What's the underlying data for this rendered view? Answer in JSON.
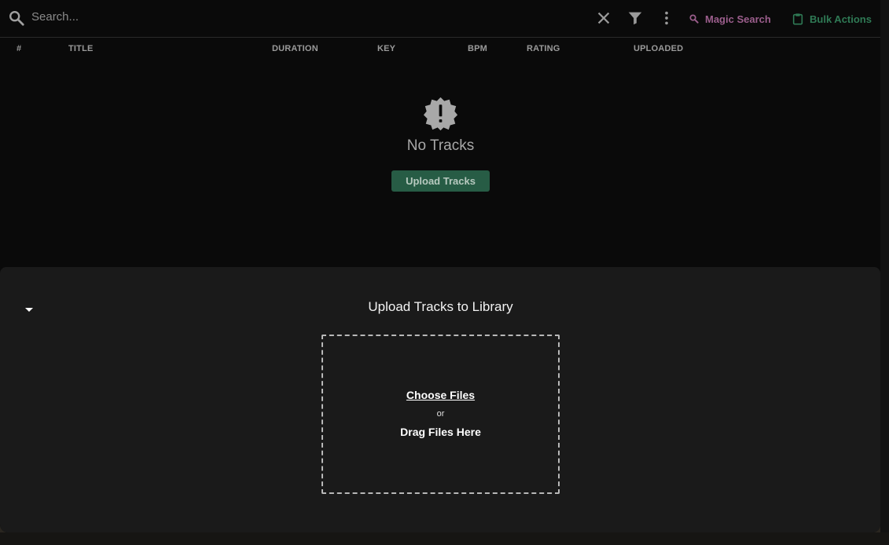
{
  "search": {
    "placeholder": "Search..."
  },
  "toolbar": {
    "clear_icon": "close-icon",
    "filter_icon": "filter-icon",
    "more_icon": "more-vert-icon",
    "magic_search_label": "Magic Search",
    "bulk_actions_label": "Bulk Actions"
  },
  "table": {
    "columns": [
      "#",
      "TITLE",
      "DURATION",
      "KEY",
      "BPM",
      "RATING",
      "UPLOADED"
    ]
  },
  "empty_state": {
    "icon": "alert-badge-icon",
    "title": "No Tracks",
    "button_label": "Upload Tracks"
  },
  "upload": {
    "title": "Upload Tracks to Library",
    "choose_files": "Choose Files",
    "or": "or",
    "drag_files": "Drag Files Here"
  },
  "colors": {
    "accent_green": "#275c45",
    "magic_purple": "#9b5e8c",
    "bulk_green": "#2f7a55"
  }
}
